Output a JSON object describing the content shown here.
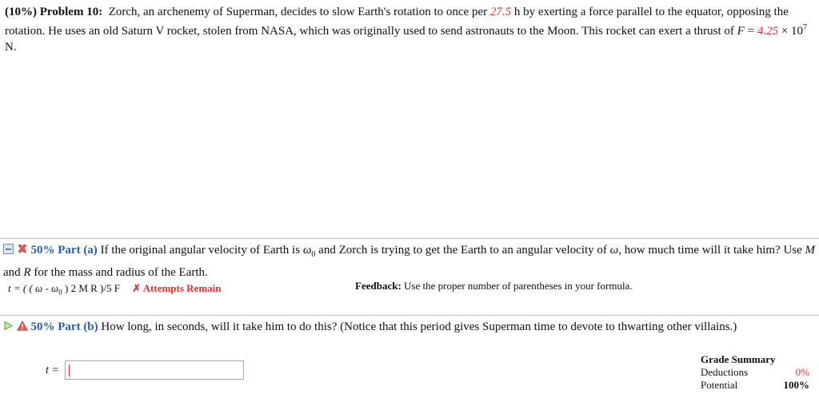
{
  "problem": {
    "header": "(10%) Problem 10:",
    "text_1": "Zorch, an archenemy of Superman, decides to slow Earth's rotation to once per",
    "period_value": "27.5",
    "text_2": "h by exerting a force parallel to the equator, opposing the rotation. He uses an old Saturn V rocket, stolen from NASA, which was originally used to send astronauts to the Moon. This rocket can exert a thrust of",
    "force_symbol": "F",
    "equals": "=",
    "force_value": "4.25",
    "times_ten": "× 10",
    "exponent": "7",
    "unit": "N."
  },
  "part_a": {
    "title": "50% Part (a)",
    "text_1": "If the original angular velocity of Earth is",
    "omega0": "ω",
    "omega0_sub": "0",
    "text_2": "and Zorch is trying to get the Earth to an angular velocity of",
    "omega": "ω",
    "text_3": ", how much time will it take him? Use",
    "M": "M",
    "text_4": "and",
    "R": "R",
    "text_5": "for the mass and radius of the Earth.",
    "answer_prefix": "t = ( ( ω - ω",
    "answer_sub": "0",
    "answer_suffix": ") 2 M R )/5 F",
    "attempts": "✗ Attempts Remain",
    "feedback_label": "Feedback:",
    "feedback_text": "Use the proper number of parentheses in your formula."
  },
  "part_b": {
    "title": "50% Part (b)",
    "text": "How long, in seconds, will it take him to do this? (Notice that this period gives Superman time to devote to thwarting other villains.)",
    "input_label": "t =",
    "input_value": ""
  },
  "grade_summary": {
    "title": "Grade Summary",
    "deductions_label": "Deductions",
    "deductions_value": "0%",
    "potential_label": "Potential",
    "potential_value": "100%"
  },
  "colors": {
    "accent": "#2a5db0",
    "error": "#e03030"
  },
  "icons": [
    "collapse-icon",
    "incorrect-icon",
    "expand-icon",
    "warning-icon"
  ]
}
